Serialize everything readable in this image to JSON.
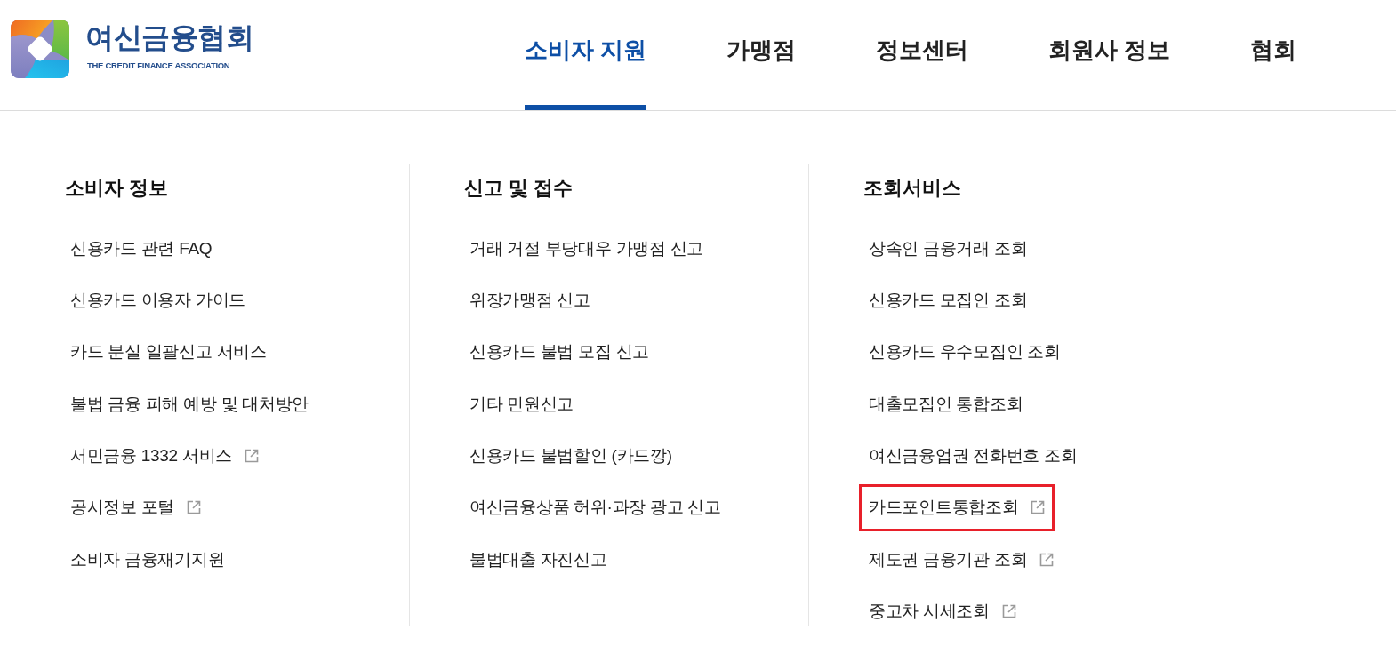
{
  "logo": {
    "name": "여신금융협회",
    "tagline": "THE CREDIT FINANCE ASSOCIATION"
  },
  "nav": [
    {
      "label": "소비자 지원",
      "selected": true
    },
    {
      "label": "가맹점",
      "selected": false
    },
    {
      "label": "정보센터",
      "selected": false
    },
    {
      "label": "회원사 정보",
      "selected": false
    },
    {
      "label": "협회",
      "selected": false
    }
  ],
  "menu_columns": [
    {
      "heading": "소비자 정보",
      "items": [
        {
          "label": "신용카드 관련 FAQ",
          "kind": "internal",
          "highlighted": false
        },
        {
          "label": "신용카드 이용자 가이드",
          "kind": "internal",
          "highlighted": false
        },
        {
          "label": "카드 분실 일괄신고 서비스",
          "kind": "internal",
          "highlighted": false
        },
        {
          "label": "불법 금융 피해 예방 및 대처방안",
          "kind": "internal",
          "highlighted": false
        },
        {
          "label": "서민금융 1332 서비스",
          "kind": "external",
          "highlighted": false
        },
        {
          "label": "공시정보 포털",
          "kind": "external",
          "highlighted": false
        },
        {
          "label": "소비자 금융재기지원",
          "kind": "internal",
          "highlighted": false
        }
      ]
    },
    {
      "heading": "신고 및 접수",
      "items": [
        {
          "label": "거래 거절 부당대우 가맹점 신고",
          "kind": "internal",
          "highlighted": false
        },
        {
          "label": "위장가맹점 신고",
          "kind": "internal",
          "highlighted": false
        },
        {
          "label": "신용카드 불법 모집 신고",
          "kind": "internal",
          "highlighted": false
        },
        {
          "label": "기타 민원신고",
          "kind": "internal",
          "highlighted": false
        },
        {
          "label": "신용카드 불법할인 (카드깡)",
          "kind": "internal",
          "highlighted": false
        },
        {
          "label": "여신금융상품 허위·과장 광고 신고",
          "kind": "internal",
          "highlighted": false
        },
        {
          "label": "불법대출 자진신고",
          "kind": "internal",
          "highlighted": false
        }
      ]
    },
    {
      "heading": "조회서비스",
      "items": [
        {
          "label": "상속인 금융거래 조회",
          "kind": "internal",
          "highlighted": false
        },
        {
          "label": "신용카드 모집인 조회",
          "kind": "internal",
          "highlighted": false
        },
        {
          "label": "신용카드 우수모집인 조회",
          "kind": "internal",
          "highlighted": false
        },
        {
          "label": "대출모집인 통합조회",
          "kind": "internal",
          "highlighted": false
        },
        {
          "label": "여신금융업권 전화번호 조회",
          "kind": "internal",
          "highlighted": false
        },
        {
          "label": "카드포인트통합조회",
          "kind": "external",
          "highlighted": true
        },
        {
          "label": "제도권 금융기관 조회",
          "kind": "external",
          "highlighted": false
        },
        {
          "label": "중고차 시세조회",
          "kind": "external",
          "highlighted": false
        }
      ]
    }
  ]
}
